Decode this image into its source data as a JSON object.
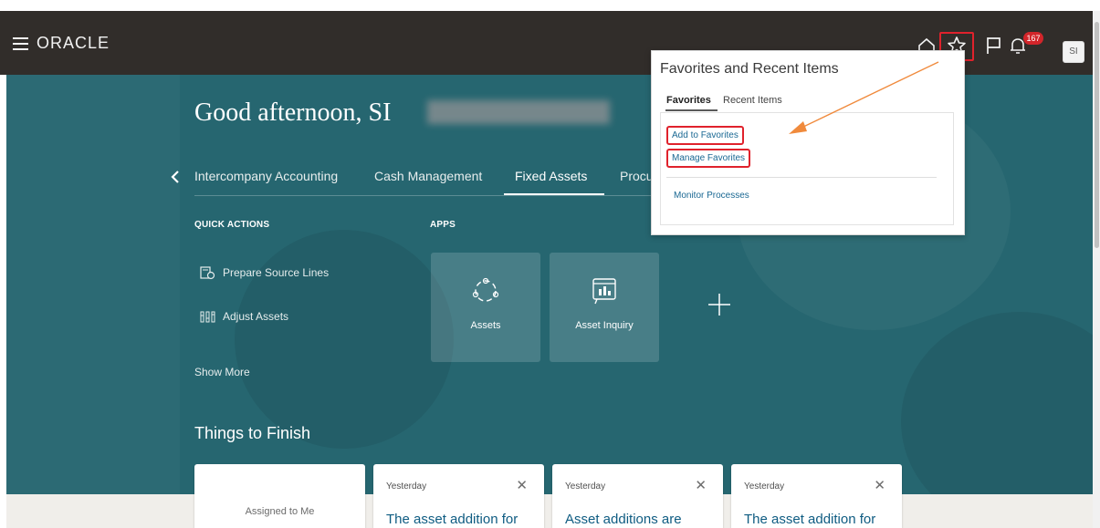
{
  "header": {
    "logo": "ORACLE",
    "notification_count": "167",
    "avatar_initials": "SI"
  },
  "greeting": "Good afternoon, SI",
  "tabs": [
    {
      "label": "Intercompany Accounting"
    },
    {
      "label": "Cash Management"
    },
    {
      "label": "Fixed Assets"
    },
    {
      "label": "Procu"
    }
  ],
  "quick_actions": {
    "heading": "QUICK ACTIONS",
    "items": [
      {
        "label": "Prepare Source Lines"
      },
      {
        "label": "Adjust Assets"
      }
    ],
    "show_more": "Show More"
  },
  "apps": {
    "heading": "APPS",
    "items": [
      {
        "label": "Assets"
      },
      {
        "label": "Asset Inquiry"
      }
    ]
  },
  "things_to_finish": {
    "heading": "Things to Finish",
    "assigned": "Assigned to Me",
    "cards": [
      {
        "when": "Yesterday",
        "text": "The asset addition for"
      },
      {
        "when": "Yesterday",
        "text": "Asset additions are"
      },
      {
        "when": "Yesterday",
        "text": "The asset addition for"
      }
    ]
  },
  "favorites_panel": {
    "title": "Favorites and Recent Items",
    "tabs": [
      "Favorites",
      "Recent Items"
    ],
    "links": {
      "add": "Add to Favorites",
      "manage": "Manage Favorites",
      "monitor": "Monitor Processes"
    }
  },
  "colors": {
    "header_bg": "#312d2a",
    "hero_bg": "#266670",
    "highlight": "#e0222c",
    "arrow": "#f08a3c",
    "link": "#1a6893"
  }
}
